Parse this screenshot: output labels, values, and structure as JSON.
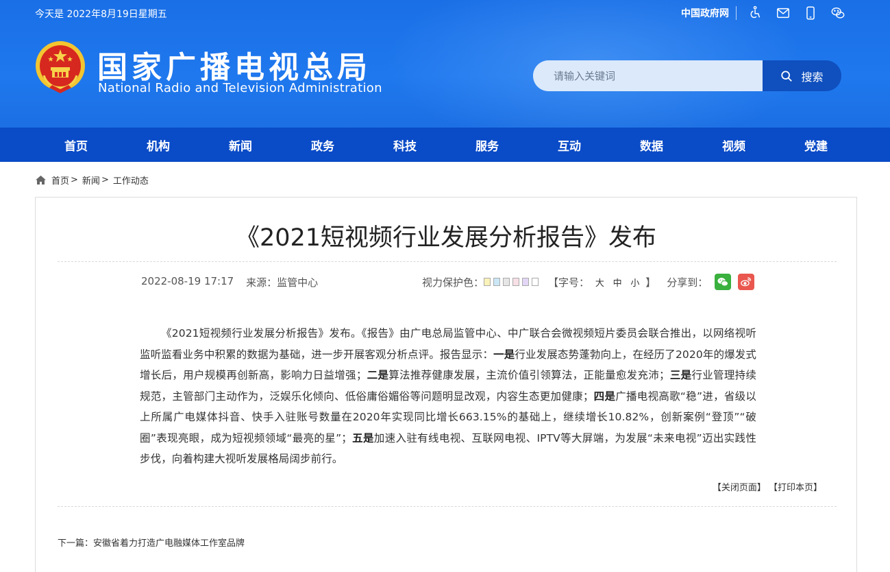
{
  "header": {
    "date": "今天是 2022年8月19日星期五",
    "gov_link": "中国政府网",
    "title_cn": "国家广播电视总局",
    "title_en": "National Radio and Television Administration",
    "icons": [
      "accessibility-icon",
      "mail-icon",
      "mobile-icon",
      "wechat-icon"
    ]
  },
  "search": {
    "placeholder": "请输入关键词",
    "button_label": "搜索"
  },
  "nav": {
    "items": [
      "首页",
      "机构",
      "新闻",
      "政务",
      "科技",
      "服务",
      "互动",
      "数据",
      "视频",
      "党建"
    ]
  },
  "breadcrumb": {
    "items": [
      "首页",
      "新闻",
      "工作动态"
    ],
    "separator": ">"
  },
  "article": {
    "title": "《2021短视频行业发展分析报告》发布",
    "datetime": "2022-08-19 17:17",
    "source": "来源：监管中心",
    "eye_label": "视力保护色：",
    "eye_colors": [
      "#f9f2b9",
      "#cbe7f6",
      "#e6e6e6",
      "#f7e0e6",
      "#e3d6f6",
      "#ffffff"
    ],
    "fontsize_open": "【字号：",
    "fontsize_large": "大",
    "fontsize_medium": "中",
    "fontsize_small": "小",
    "fontsize_close": "】",
    "share_label": "分享到：",
    "p_1": "《2021短视频行业发展分析报告》发布。《报告》由广电总局监管中心、中广联合会微视频短片委员会联合推出，以网络视听监听监看业务中积累的数据为基础，进一步开展客观分析点评。报告显示：",
    "b_1": "一是",
    "p_2": "行业发展态势蓬勃向上，在经历了2020年的爆发式增长后，用户规模再创新高，影响力日益增强；",
    "b_2": "二是",
    "p_3": "算法推荐健康发展，主流价值引领算法，正能量愈发充沛；",
    "b_3": "三是",
    "p_4": "行业管理持续规范，主管部门主动作为，泛娱乐化倾向、低俗庸俗媚俗等问题明显改观，内容生态更加健康；",
    "b_4": "四是",
    "p_5": "广播电视高歌“稳”进，省级以上所属广电媒体抖音、快手入驻账号数量在2020年实现同比增长663.15%的基础上，继续增长10.82%，创新案例“登顶”“破圈”表现亮眼，成为短视频领域“最亮的星”；",
    "b_5": "五是",
    "p_6": "加速入驻有线电视、互联网电视、IPTV等大屏端，为发展“未来电视”迈出实践性步伐，向着构建大视听发展格局阔步前行。",
    "close_page": "【关闭页面】",
    "print_page": "【打印本页】",
    "next_article": "下一篇：安徽省着力打造广电融媒体工作室品牌"
  },
  "colors": {
    "header_blue": "#1f78ee",
    "nav_blue": "#0a4bc7",
    "search_button": "#0f4fbe",
    "wechat_green": "#3ab03e",
    "weibo_red": "#e9574e"
  }
}
